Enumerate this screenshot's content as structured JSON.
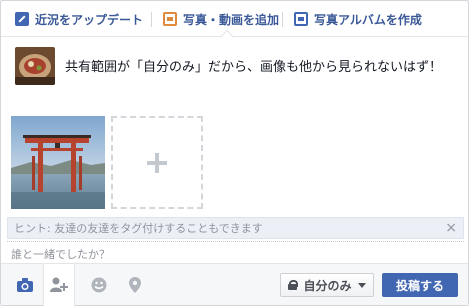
{
  "tabs": [
    {
      "label": "近況をアップデート",
      "icon": "pencil-icon"
    },
    {
      "label": "写真・動画を追加",
      "icon": "photo-icon"
    },
    {
      "label": "写真アルバムを作成",
      "icon": "album-icon"
    }
  ],
  "post": {
    "text": "共有範囲が「自分のみ」だから、画像も他から見られないはず！"
  },
  "hint": {
    "text": "ヒント: 友達の友達をタグ付けすることもできます",
    "close": "×"
  },
  "with_label": "誰と一緒でしたか？",
  "footer": {
    "privacy_label": "自分のみ",
    "post_label": "投稿する"
  },
  "colors": {
    "accent": "#4267b2",
    "tab_text": "#3b5998",
    "photo_icon": "#e0883b"
  }
}
